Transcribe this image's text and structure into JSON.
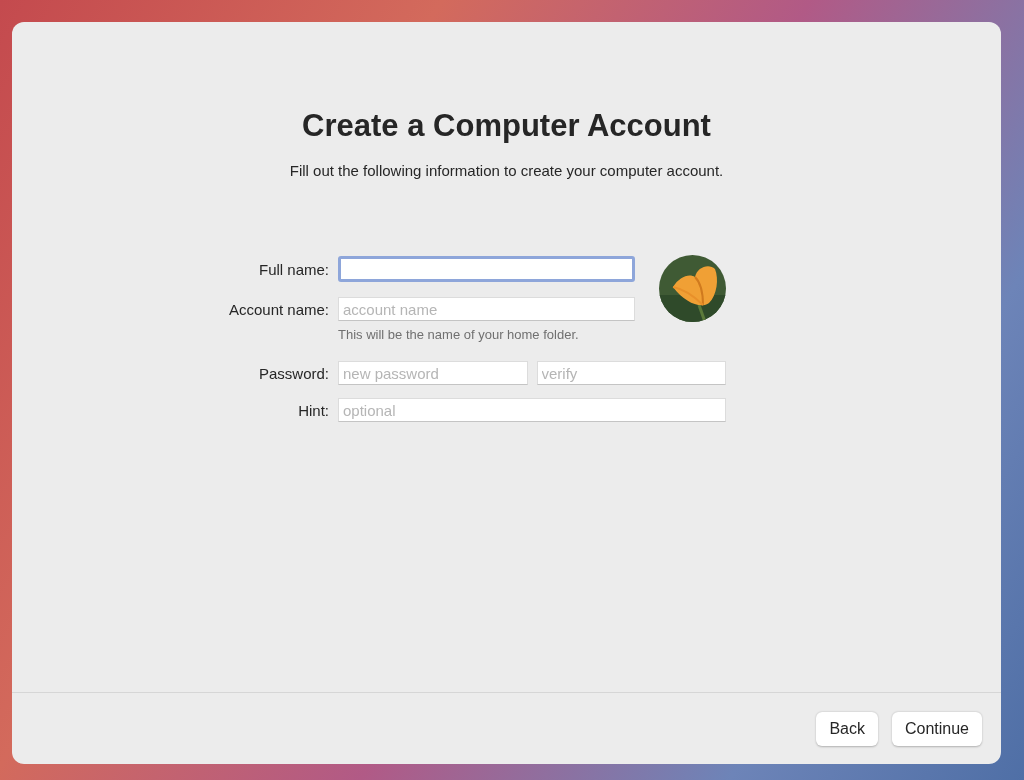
{
  "window": {
    "title": "Create a Computer Account",
    "subtitle": "Fill out the following information to create your computer account."
  },
  "form": {
    "rows": [
      {
        "label": "Full name:",
        "kind": "beside-picture",
        "fields": [
          {
            "focused": true
          }
        ]
      },
      {
        "label": "Account name:",
        "kind": "beside-picture",
        "fields": [
          {
            "placeholder": "account name",
            "focused": false
          }
        ],
        "note": "This will be the name of your home folder."
      },
      {
        "label": "Password:",
        "kind": "full",
        "fields": [
          {
            "placeholder": "new password",
            "focused": false
          },
          {
            "placeholder": "verify",
            "focused": false
          }
        ]
      },
      {
        "label": "Hint:",
        "kind": "full",
        "fields": [
          {
            "placeholder": "optional",
            "focused": false
          }
        ]
      }
    ]
  },
  "buttons": [
    {
      "label": "Back"
    },
    {
      "label": "Continue"
    }
  ]
}
